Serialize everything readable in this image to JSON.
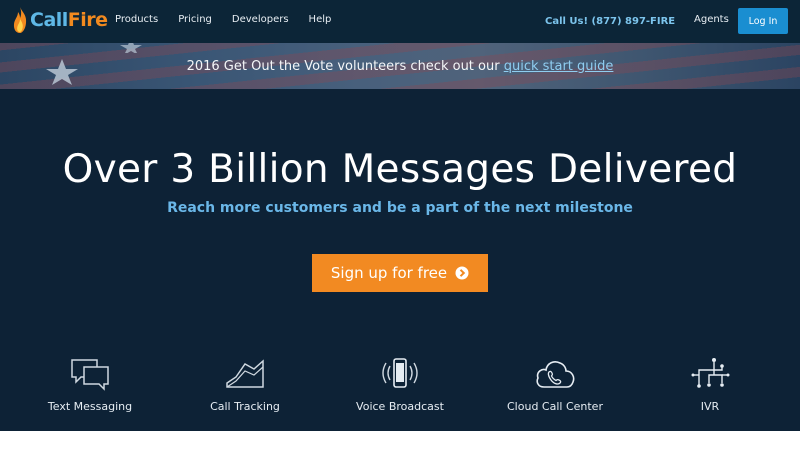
{
  "nav": {
    "brand_call": "Call",
    "brand_fire": "Fire",
    "menu": [
      "Products",
      "Pricing",
      "Developers",
      "Help"
    ],
    "phone": "Call Us! (877) 897-FIRE",
    "agents": "Agents",
    "login": "Log In"
  },
  "banner": {
    "text": "2016 Get Out the Vote volunteers check out our ",
    "link": "quick start guide"
  },
  "hero": {
    "title": "Over 3 Billion Messages Delivered",
    "subtitle": "Reach more customers and be a part of the next milestone",
    "cta": "Sign up for free"
  },
  "features": [
    {
      "label": "Text Messaging",
      "icon": "chat-bubbles-icon"
    },
    {
      "label": "Call Tracking",
      "icon": "line-chart-icon"
    },
    {
      "label": "Voice Broadcast",
      "icon": "mobile-broadcast-icon"
    },
    {
      "label": "Cloud Call Center",
      "icon": "cloud-phone-icon"
    },
    {
      "label": "IVR",
      "icon": "ivr-tree-icon"
    }
  ],
  "colors": {
    "nav_bg": "#0c2537",
    "hero_bg": "#0d2236",
    "accent_orange": "#f28a22",
    "accent_blue": "#1a8ed1",
    "link_blue": "#6ab7e8"
  }
}
